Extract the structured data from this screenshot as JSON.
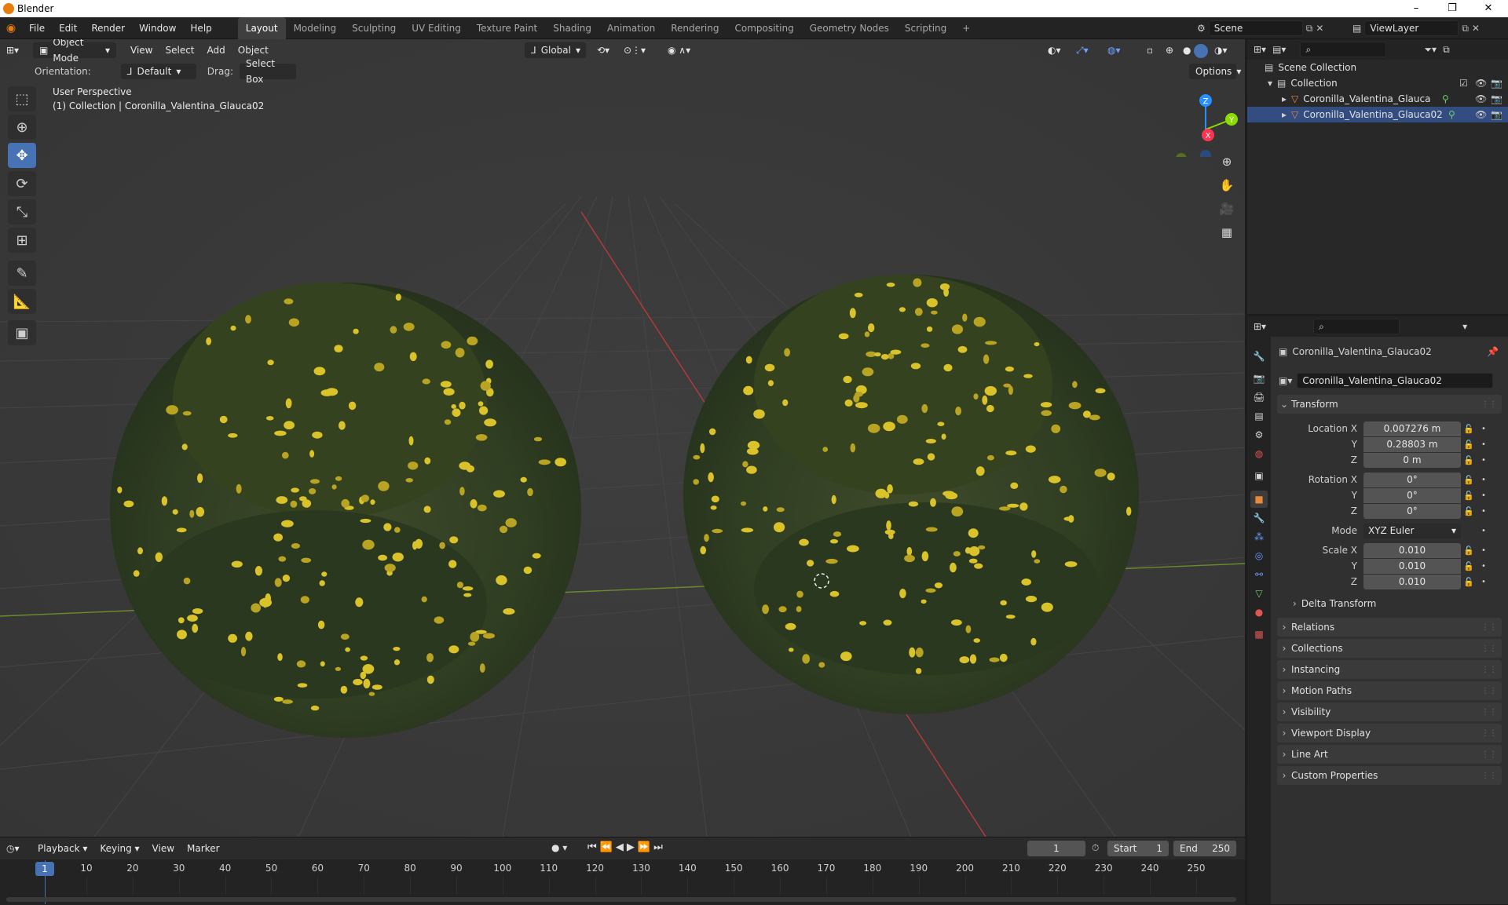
{
  "window": {
    "title": "Blender",
    "minimize": "–",
    "maximize": "❐",
    "close": "✕"
  },
  "menu": [
    "File",
    "Edit",
    "Render",
    "Window",
    "Help"
  ],
  "workspaces": [
    "Layout",
    "Modeling",
    "Sculpting",
    "UV Editing",
    "Texture Paint",
    "Shading",
    "Animation",
    "Rendering",
    "Compositing",
    "Geometry Nodes",
    "Scripting",
    "+"
  ],
  "scene": {
    "name": "Scene",
    "view_layer": "ViewLayer"
  },
  "viewport_header": {
    "mode": "Object Mode",
    "menus": [
      "View",
      "Select",
      "Add",
      "Object"
    ],
    "transform_orientation": "Global",
    "orientation_label": "Orientation:",
    "orientation_value": "Default",
    "drag_label": "Drag:",
    "drag_value": "Select Box",
    "options": "Options"
  },
  "viewport_overlay": {
    "perspective": "User Perspective",
    "collection_info": "(1) Collection | Coronilla_Valentina_Glauca02"
  },
  "gizmo": {
    "x": "X",
    "y": "Y",
    "z": "Z"
  },
  "outliner": {
    "root": "Scene Collection",
    "collection": "Collection",
    "objects": [
      "Coronilla_Valentina_Glauca",
      "Coronilla_Valentina_Glauca02"
    ]
  },
  "properties": {
    "object_name": "Coronilla_Valentina_Glauca02",
    "object_field": "Coronilla_Valentina_Glauca02",
    "transform_title": "Transform",
    "location_label": "Location X",
    "rotation_label": "Rotation X",
    "scale_label": "Scale X",
    "y_label": "Y",
    "z_label": "Z",
    "location": [
      "0.007276 m",
      "0.28803 m",
      "0 m"
    ],
    "rotation": [
      "0°",
      "0°",
      "0°"
    ],
    "mode_label": "Mode",
    "mode_value": "XYZ Euler",
    "scale": [
      "0.010",
      "0.010",
      "0.010"
    ],
    "delta_transform": "Delta Transform",
    "panels": [
      "Relations",
      "Collections",
      "Instancing",
      "Motion Paths",
      "Visibility",
      "Viewport Display",
      "Line Art",
      "Custom Properties"
    ]
  },
  "timeline": {
    "menus": [
      "Playback",
      "Keying",
      "View",
      "Marker"
    ],
    "current_frame": "1",
    "start_label": "Start",
    "start_value": "1",
    "end_label": "End",
    "end_value": "250",
    "ticks": [
      "1",
      "10",
      "20",
      "30",
      "40",
      "50",
      "60",
      "70",
      "80",
      "90",
      "100",
      "110",
      "120",
      "130",
      "140",
      "150",
      "160",
      "170",
      "180",
      "190",
      "200",
      "210",
      "220",
      "230",
      "240",
      "250"
    ]
  },
  "colors": {
    "accent": "#4772b3",
    "x_axis": "#ff3352",
    "y_axis": "#8bdc00",
    "z_axis": "#2890ff",
    "flower": "#d9c22a",
    "foliage": "#2f3d22"
  }
}
